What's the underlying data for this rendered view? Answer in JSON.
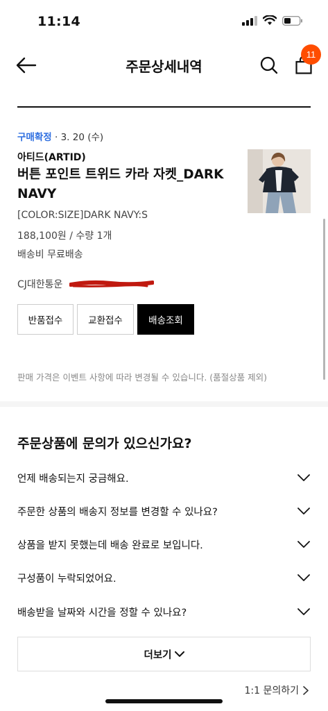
{
  "status_bar": {
    "time": "11:14"
  },
  "header": {
    "title": "주문상세내역",
    "cart_count": "11"
  },
  "order": {
    "status_label": "구매확정",
    "date": "· 3. 20 (수)",
    "brand": "아티드(ARTID)",
    "product_name": "버튼 포인트 트위드 카라 자켓_DARK NAVY",
    "option": "[COLOR:SIZE]DARK NAVY:S",
    "price_qty": "188,100원 / 수량 1개",
    "shipping_fee": "배송비 무료배송",
    "courier": "CJ대한통운"
  },
  "buttons": {
    "return": "반품접수",
    "exchange": "교환접수",
    "track": "배송조회"
  },
  "notice": "판매 가격은 이벤트 사항에 따라 변경될 수 있습니다. (품절상품 제외)",
  "faq": {
    "title": "주문상품에 문의가 있으신가요?",
    "items": [
      "언제 배송되는지 궁금해요.",
      "주문한 상품의 배송지 정보를 변경할 수 있나요?",
      "상품을 받지 못했는데 배송 완료로 보입니다.",
      "구성품이 누락되었어요.",
      "배송받을 날짜와 시간을 정할 수 있나요?"
    ],
    "more_label": "더보기"
  },
  "inquiry_link": "1:1 문의하기",
  "colors": {
    "accent_blue": "#2f6fe0",
    "badge_orange": "#ff4d00",
    "redaction_red": "#c0190f"
  }
}
